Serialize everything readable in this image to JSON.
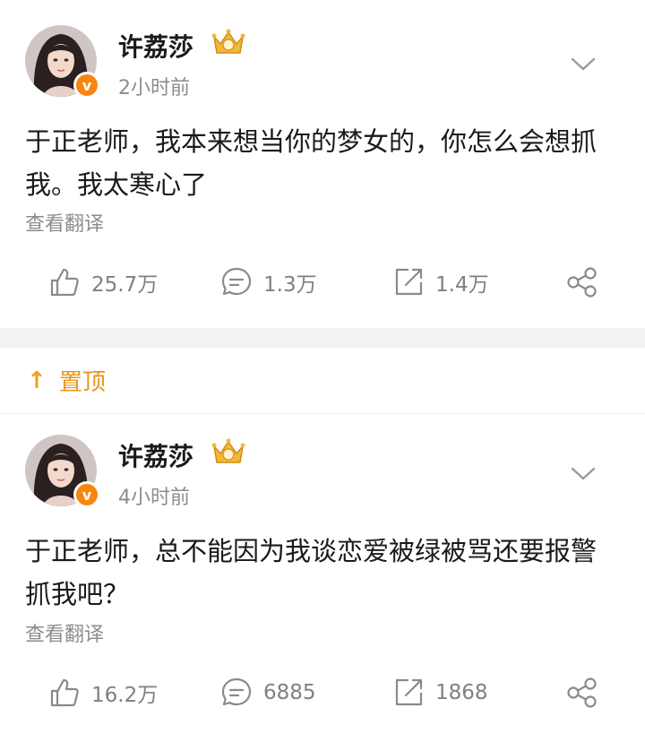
{
  "posts": [
    {
      "author": "许荔莎",
      "time": "2小时前",
      "text": "于正老师，我本来想当你的梦女的，你怎么会想抓我。我太寒心了",
      "translate": "查看翻译",
      "likes": "25.7万",
      "comments": "1.3万",
      "reposts": "1.4万"
    },
    {
      "author": "许荔莎",
      "time": "4小时前",
      "text": "于正老师，总不能因为我谈恋爱被绿被骂还要报警抓我吧？",
      "translate": "查看翻译",
      "likes": "16.2万",
      "comments": "6885",
      "reposts": "1868"
    }
  ],
  "pinned": {
    "label": "置顶",
    "icon": "up-arrow-icon"
  },
  "colors": {
    "accent_orange": "#e8961e",
    "verified_badge": "#f7860f",
    "secondary_text": "#8c8c8c"
  },
  "icons": [
    "like-icon",
    "comment-icon",
    "repost-icon",
    "share-icon",
    "chevron-down-icon",
    "crown-badge-icon",
    "verified-icon"
  ]
}
